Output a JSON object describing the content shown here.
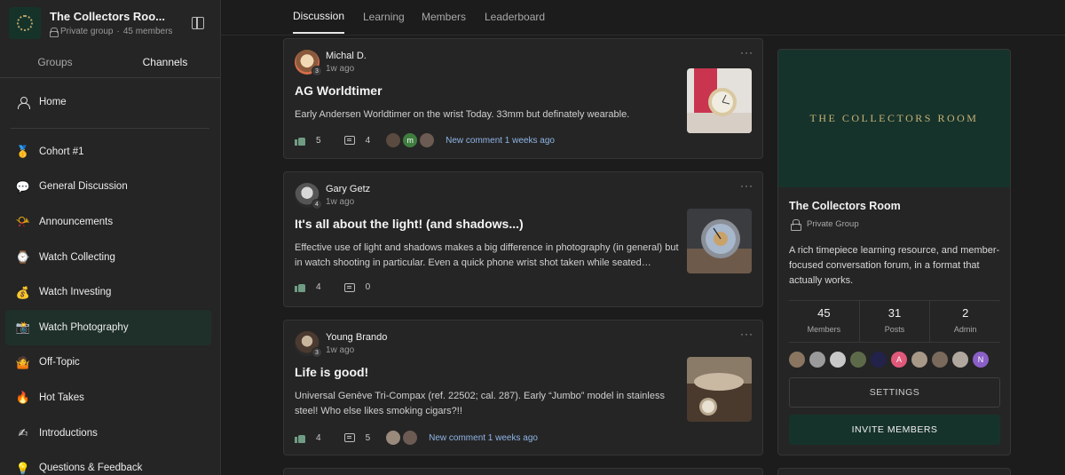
{
  "group": {
    "name": "The Collectors Roo...",
    "privacy": "Private group",
    "separator": "·",
    "members": "45 members"
  },
  "side_tabs": [
    "Groups",
    "Channels"
  ],
  "nav": [
    {
      "label": "Home",
      "icon": "user-icon"
    },
    {
      "label": "Cohort #1",
      "icon": "medal-icon",
      "glyph": "🥇"
    },
    {
      "label": "General Discussion",
      "icon": "speech-bubble-icon",
      "glyph": "💬"
    },
    {
      "label": "Announcements",
      "icon": "megaphone-icon",
      "glyph": "📯"
    },
    {
      "label": "Watch Collecting",
      "icon": "watch-icon",
      "glyph": "⌚"
    },
    {
      "label": "Watch Investing",
      "icon": "money-bag-icon",
      "glyph": "💰"
    },
    {
      "label": "Watch Photography",
      "icon": "camera-icon",
      "glyph": "📸"
    },
    {
      "label": "Off-Topic",
      "icon": "person-shrug-icon",
      "glyph": "🤷"
    },
    {
      "label": "Hot Takes",
      "icon": "fire-icon",
      "glyph": "🔥"
    },
    {
      "label": "Introductions",
      "icon": "writing-hand-icon",
      "glyph": "✍"
    },
    {
      "label": "Questions & Feedback",
      "icon": "light-bulb-icon",
      "glyph": "💡"
    }
  ],
  "top_tabs": [
    "Discussion",
    "Learning",
    "Members",
    "Leaderboard"
  ],
  "posts": [
    {
      "author": "Michal D.",
      "level": "3",
      "time": "1w ago",
      "title": "AG Worldtimer",
      "body": "Early Andersen Worldtimer on the wrist Today. 33mm but definately wearable.",
      "likes": "5",
      "comments": "4",
      "commenters": [
        "",
        "m",
        ""
      ],
      "new_comment": "New comment 1 weeks ago"
    },
    {
      "author": "Gary Getz",
      "level": "4",
      "time": "1w ago",
      "title": "It's all about the light! (and shadows...)",
      "body": "Effective use of light and shadows makes a big difference in photography (in general) but in watch shooting in particular. Even a quick phone wrist shot taken while seated…",
      "likes": "4",
      "comments": "0"
    },
    {
      "author": "Young Brando",
      "level": "3",
      "time": "1w ago",
      "title": "Life is good!",
      "body": "Universal Genève Tri-Compax (ref. 22502; cal. 287). Early “Jumbo” model in stainless steel! Who else likes smoking cigars?!!",
      "likes": "4",
      "comments": "5",
      "commenters": [
        "",
        ""
      ],
      "new_comment": "New comment 1 weeks ago"
    }
  ],
  "more_glyph": "···",
  "panel": {
    "banner_text": "THE COLLECTORS ROOM",
    "name": "The Collectors Room",
    "privacy": "Private Group",
    "description": "A rich timepiece learning resource, and member-focused conversation forum, in a format that actually works.",
    "stats": [
      {
        "num": "45",
        "label": "Members"
      },
      {
        "num": "31",
        "label": "Posts"
      },
      {
        "num": "2",
        "label": "Admin"
      }
    ],
    "member_initials": [
      "",
      "",
      "",
      "",
      "",
      "A",
      "",
      "",
      "",
      "N"
    ],
    "settings_label": "SETTINGS",
    "invite_label": "INVITE MEMBERS"
  },
  "colors": {
    "accent_green": "#16332b",
    "gold": "#c7b277",
    "link_blue": "#8fb5e6",
    "like_green": "#6f9c83"
  }
}
